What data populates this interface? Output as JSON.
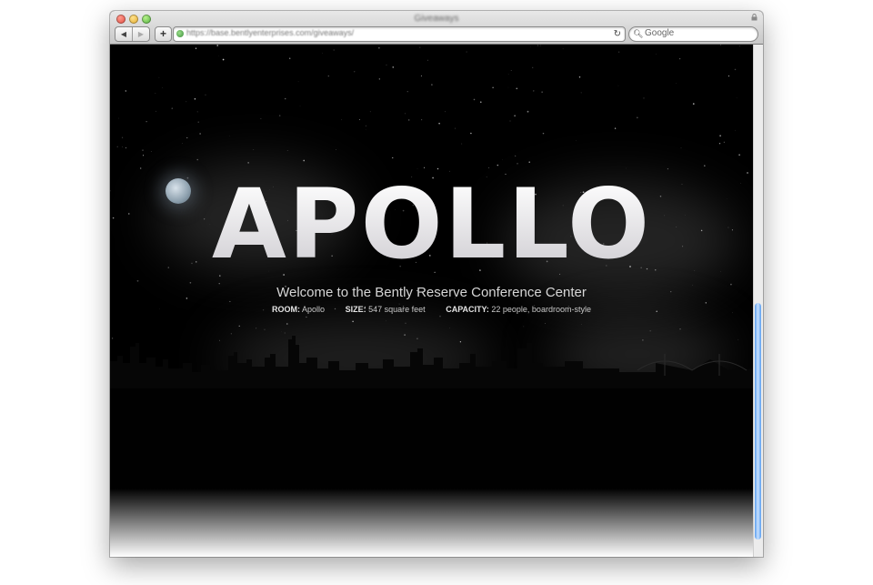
{
  "window": {
    "title": "Giveaways",
    "url": "https://base.bentlyenterprises.com/giveaways/",
    "search_placeholder": "Google",
    "nav": {
      "back": "◀",
      "forward": "▶",
      "add": "+"
    }
  },
  "page": {
    "title": "APOLLO",
    "welcome": "Welcome to the Bently Reserve Conference Center",
    "details": [
      {
        "label": "ROOM:",
        "value": "Apollo"
      },
      {
        "label": "SIZE:",
        "value": "547 square feet"
      },
      {
        "label": "CAPACITY:",
        "value": "22 people, boardroom-style"
      }
    ]
  },
  "colors": {
    "scroll_thumb": "#5b9ef0",
    "background": "#000000",
    "title": "#e9e8ea"
  },
  "icons": [
    "lock-icon",
    "back-icon",
    "forward-icon",
    "add-tab-icon",
    "reload-icon",
    "search-icon",
    "favicon-icon",
    "moon-icon"
  ]
}
